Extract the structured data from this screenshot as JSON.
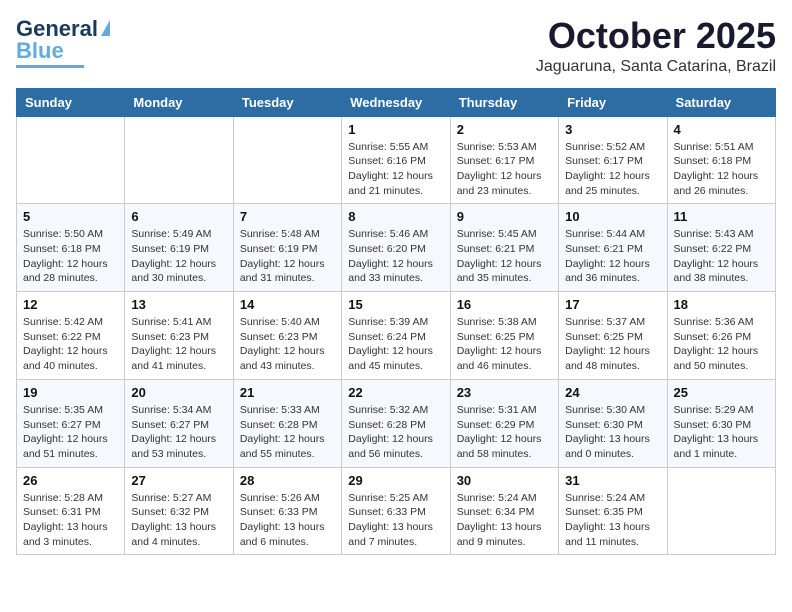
{
  "logo": {
    "line1": "General",
    "line2": "Blue"
  },
  "header": {
    "title": "October 2025",
    "subtitle": "Jaguaruna, Santa Catarina, Brazil"
  },
  "weekdays": [
    "Sunday",
    "Monday",
    "Tuesday",
    "Wednesday",
    "Thursday",
    "Friday",
    "Saturday"
  ],
  "weeks": [
    [
      {
        "day": "",
        "info": ""
      },
      {
        "day": "",
        "info": ""
      },
      {
        "day": "",
        "info": ""
      },
      {
        "day": "1",
        "info": "Sunrise: 5:55 AM\nSunset: 6:16 PM\nDaylight: 12 hours\nand 21 minutes."
      },
      {
        "day": "2",
        "info": "Sunrise: 5:53 AM\nSunset: 6:17 PM\nDaylight: 12 hours\nand 23 minutes."
      },
      {
        "day": "3",
        "info": "Sunrise: 5:52 AM\nSunset: 6:17 PM\nDaylight: 12 hours\nand 25 minutes."
      },
      {
        "day": "4",
        "info": "Sunrise: 5:51 AM\nSunset: 6:18 PM\nDaylight: 12 hours\nand 26 minutes."
      }
    ],
    [
      {
        "day": "5",
        "info": "Sunrise: 5:50 AM\nSunset: 6:18 PM\nDaylight: 12 hours\nand 28 minutes."
      },
      {
        "day": "6",
        "info": "Sunrise: 5:49 AM\nSunset: 6:19 PM\nDaylight: 12 hours\nand 30 minutes."
      },
      {
        "day": "7",
        "info": "Sunrise: 5:48 AM\nSunset: 6:19 PM\nDaylight: 12 hours\nand 31 minutes."
      },
      {
        "day": "8",
        "info": "Sunrise: 5:46 AM\nSunset: 6:20 PM\nDaylight: 12 hours\nand 33 minutes."
      },
      {
        "day": "9",
        "info": "Sunrise: 5:45 AM\nSunset: 6:21 PM\nDaylight: 12 hours\nand 35 minutes."
      },
      {
        "day": "10",
        "info": "Sunrise: 5:44 AM\nSunset: 6:21 PM\nDaylight: 12 hours\nand 36 minutes."
      },
      {
        "day": "11",
        "info": "Sunrise: 5:43 AM\nSunset: 6:22 PM\nDaylight: 12 hours\nand 38 minutes."
      }
    ],
    [
      {
        "day": "12",
        "info": "Sunrise: 5:42 AM\nSunset: 6:22 PM\nDaylight: 12 hours\nand 40 minutes."
      },
      {
        "day": "13",
        "info": "Sunrise: 5:41 AM\nSunset: 6:23 PM\nDaylight: 12 hours\nand 41 minutes."
      },
      {
        "day": "14",
        "info": "Sunrise: 5:40 AM\nSunset: 6:23 PM\nDaylight: 12 hours\nand 43 minutes."
      },
      {
        "day": "15",
        "info": "Sunrise: 5:39 AM\nSunset: 6:24 PM\nDaylight: 12 hours\nand 45 minutes."
      },
      {
        "day": "16",
        "info": "Sunrise: 5:38 AM\nSunset: 6:25 PM\nDaylight: 12 hours\nand 46 minutes."
      },
      {
        "day": "17",
        "info": "Sunrise: 5:37 AM\nSunset: 6:25 PM\nDaylight: 12 hours\nand 48 minutes."
      },
      {
        "day": "18",
        "info": "Sunrise: 5:36 AM\nSunset: 6:26 PM\nDaylight: 12 hours\nand 50 minutes."
      }
    ],
    [
      {
        "day": "19",
        "info": "Sunrise: 5:35 AM\nSunset: 6:27 PM\nDaylight: 12 hours\nand 51 minutes."
      },
      {
        "day": "20",
        "info": "Sunrise: 5:34 AM\nSunset: 6:27 PM\nDaylight: 12 hours\nand 53 minutes."
      },
      {
        "day": "21",
        "info": "Sunrise: 5:33 AM\nSunset: 6:28 PM\nDaylight: 12 hours\nand 55 minutes."
      },
      {
        "day": "22",
        "info": "Sunrise: 5:32 AM\nSunset: 6:28 PM\nDaylight: 12 hours\nand 56 minutes."
      },
      {
        "day": "23",
        "info": "Sunrise: 5:31 AM\nSunset: 6:29 PM\nDaylight: 12 hours\nand 58 minutes."
      },
      {
        "day": "24",
        "info": "Sunrise: 5:30 AM\nSunset: 6:30 PM\nDaylight: 13 hours\nand 0 minutes."
      },
      {
        "day": "25",
        "info": "Sunrise: 5:29 AM\nSunset: 6:30 PM\nDaylight: 13 hours\nand 1 minute."
      }
    ],
    [
      {
        "day": "26",
        "info": "Sunrise: 5:28 AM\nSunset: 6:31 PM\nDaylight: 13 hours\nand 3 minutes."
      },
      {
        "day": "27",
        "info": "Sunrise: 5:27 AM\nSunset: 6:32 PM\nDaylight: 13 hours\nand 4 minutes."
      },
      {
        "day": "28",
        "info": "Sunrise: 5:26 AM\nSunset: 6:33 PM\nDaylight: 13 hours\nand 6 minutes."
      },
      {
        "day": "29",
        "info": "Sunrise: 5:25 AM\nSunset: 6:33 PM\nDaylight: 13 hours\nand 7 minutes."
      },
      {
        "day": "30",
        "info": "Sunrise: 5:24 AM\nSunset: 6:34 PM\nDaylight: 13 hours\nand 9 minutes."
      },
      {
        "day": "31",
        "info": "Sunrise: 5:24 AM\nSunset: 6:35 PM\nDaylight: 13 hours\nand 11 minutes."
      },
      {
        "day": "",
        "info": ""
      }
    ]
  ]
}
